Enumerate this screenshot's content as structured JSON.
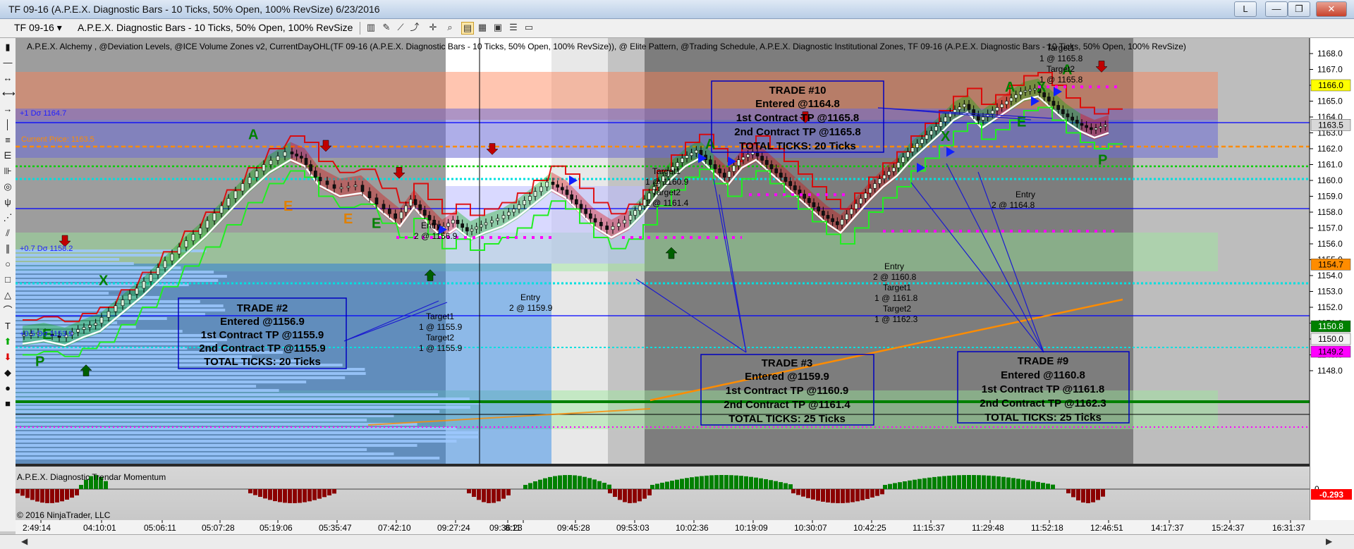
{
  "window": {
    "title": "TF 09-16 (A.P.E.X. Diagnostic Bars - 10 Ticks, 50% Open, 100% RevSize)  6/23/2016",
    "buttons": [
      "L",
      "—",
      "❐",
      "✕"
    ]
  },
  "toolbar": {
    "instrument": "TF 09-16",
    "bar_type": "A.P.E.X. Diagnostic Bars - 10 Ticks, 50% Open, 100% RevSize"
  },
  "indicator_header": "A.P.E.X. Alchemy , @Deviation Levels, @ICE Volume Zones v2, CurrentDayOHL(TF 09-16 (A.P.E.X. Diagnostic Bars - 10 Ticks, 50% Open, 100% RevSize)), @ Elite Pattern, @Trading Schedule, A.P.E.X. Diagnostic Institutional Zones, TF 09-16 (A.P.E.X. Diagnostic Bars - 10 Ticks, 50% Open, 100% RevSize)",
  "level_labels": {
    "dev1": "+1 Dσ 1164.7",
    "current": "Current Price: 1163.5",
    "dev07": "+0.7 Dσ 1158.2",
    "dev05": "+0.5 Dσ 1153.9"
  },
  "price_axis": {
    "ticks": [
      "1168.0",
      "1167.0",
      "1166.0",
      "1165.0",
      "1164.0",
      "1163.0",
      "1162.0",
      "1161.0",
      "1160.0",
      "1159.0",
      "1158.0",
      "1157.0",
      "1156.0",
      "1155.0",
      "1154.0",
      "1153.0",
      "1152.0",
      "1151.0",
      "1150.0",
      "1149.0",
      "1148.0"
    ],
    "tick_values": [
      1168,
      1167,
      1166,
      1165,
      1164,
      1163,
      1162,
      1161,
      1160,
      1159,
      1158,
      1157,
      1156,
      1155,
      1154,
      1153,
      1152,
      1151,
      1150,
      1149,
      1148
    ],
    "badges": [
      {
        "text": "1166.0",
        "value": 1166.0,
        "bg": "#ffff00",
        "fg": "#000000"
      },
      {
        "text": "1163.5",
        "value": 1163.5,
        "bg": "#d8d8d8",
        "fg": "#000000"
      },
      {
        "text": "1154.7",
        "value": 1154.7,
        "bg": "#ff8c00",
        "fg": "#000000"
      },
      {
        "text": "1150.8",
        "value": 1150.8,
        "bg": "#008000",
        "fg": "#ffffff"
      },
      {
        "text": "1150.0",
        "value": 1150.0,
        "bg": "#f2f2f2",
        "fg": "#000000"
      },
      {
        "text": "1149.2",
        "value": 1149.2,
        "bg": "#ff00ff",
        "fg": "#000000"
      }
    ]
  },
  "time_axis": {
    "labels": [
      "2:49:14",
      "04:10:01",
      "05:06:11",
      "05:07:28",
      "05:19:06",
      "05:35:47",
      "07:42:10",
      "09:27:24",
      "09:36:23",
      "09:38:11",
      "09:45:28",
      "09:53:03",
      "10:02:36",
      "10:19:09",
      "10:30:07",
      "10:42:25",
      "11:15:37",
      "11:29:48",
      "11:52:18",
      "12:46:51",
      "14:17:37",
      "15:24:37",
      "16:31:37"
    ],
    "display": [
      "2:49:14",
      "04:10:01",
      "05:06:11",
      "05:07:28",
      "05:19:06",
      "05:35:47",
      "07:42:10",
      "09:27:24",
      "09:36:23",
      "8:11",
      "09:45:28",
      "09:53:03",
      "10:02:36",
      "10:19:09",
      "10:30:07",
      "10:42:25",
      "11:15:37",
      "11:29:48",
      "11:52:18",
      "12:46:51",
      "14:17:37",
      "15:24:37",
      "16:31:37"
    ]
  },
  "markers": {
    "letters": [
      {
        "t": "A",
        "color": "#008000"
      },
      {
        "t": "X",
        "color": "#008000"
      },
      {
        "t": "E",
        "color": "#008000"
      },
      {
        "t": "P",
        "color": "#008000"
      },
      {
        "t": "E",
        "color": "#e08000"
      },
      {
        "t": "E",
        "color": "#e08000"
      },
      {
        "t": "E",
        "color": "#008000"
      },
      {
        "t": "A",
        "color": "#008000"
      },
      {
        "t": "X",
        "color": "#008000"
      },
      {
        "t": "A",
        "color": "#008000"
      },
      {
        "t": "X",
        "color": "#008000"
      },
      {
        "t": "E",
        "color": "#008000"
      },
      {
        "t": "P",
        "color": "#008000"
      },
      {
        "t": "A",
        "color": "#008000"
      }
    ]
  },
  "annotations": {
    "trade2_entry": [
      "Entry",
      "2 @ 1156.9"
    ],
    "trade2_targets": [
      "Target1",
      "1 @ 1155.9",
      "Target2",
      "1 @ 1155.9"
    ],
    "trade3_entry": [
      "Entry",
      "2 @ 1159.9"
    ],
    "trade3_targets": [
      "Target1",
      "1 @ 1160.9",
      "Target2",
      "1 @ 1161.4"
    ],
    "trade9_entry": [
      "Entry",
      "2 @ 1160.8"
    ],
    "trade9_targets": [
      "Target1",
      "1 @ 1161.8",
      "Target2",
      "1 @ 1162.3"
    ],
    "trade10_entry": [
      "Entry",
      "2 @ 1164.8"
    ],
    "trade10_targets": [
      "Target1",
      "1 @ 1165.8",
      "Target2",
      "1 @ 1165.8"
    ]
  },
  "trade_boxes": [
    {
      "lines": [
        "TRADE #2",
        "Entered @1156.9",
        "1st Contract TP @1155.9",
        "2nd Contract TP @1155.9",
        "TOTAL TICKS: 20 Ticks"
      ]
    },
    {
      "lines": [
        "TRADE #3",
        "Entered @1159.9",
        "1st Contract TP @1160.9",
        "2nd Contract TP @1161.4",
        "TOTAL TICKS: 25 Ticks"
      ]
    },
    {
      "lines": [
        "TRADE #9",
        "Entered @1160.8",
        "1st Contract TP @1161.8",
        "2nd Contract TP @1162.3",
        "TOTAL TICKS: 25 Ticks"
      ]
    },
    {
      "lines": [
        "TRADE #10",
        "Entered @1164.8",
        "1st Contract TP @1165.8",
        "2nd Contract TP @1165.8",
        "TOTAL TICKS: 20 Ticks"
      ]
    }
  ],
  "lower_panel": {
    "title": "A.P.E.X. Diagnostic Trendar Momentum",
    "copyright": "© 2016 NinjaTrader, LLC",
    "badge": {
      "text": "-0.293",
      "value": -0.293,
      "bg": "#ff0000",
      "fg": "#ffffff"
    },
    "ticks": [
      "0"
    ]
  },
  "colors": {
    "bull": "#00c000",
    "bear": "#e00000",
    "level_cyan": "#00e0e0",
    "level_magenta": "#ff00ff",
    "current_price": "#ff8c00",
    "trade_box_border": "#0000c0",
    "accent_blue": "#0000ff"
  }
}
